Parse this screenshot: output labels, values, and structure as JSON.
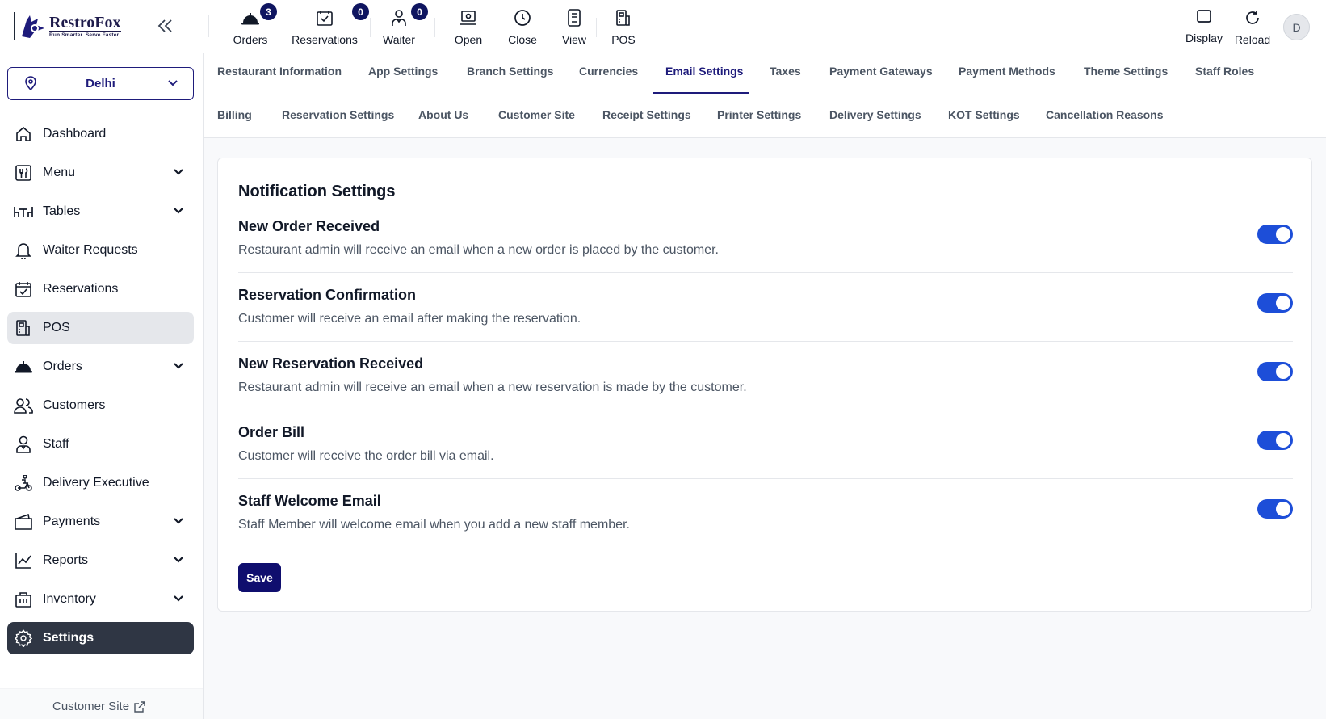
{
  "brand": {
    "name": "RestroFox",
    "tagline": "Run Smarter. Serve Faster"
  },
  "topbar": {
    "buttons": [
      {
        "label": "Orders",
        "badge": "3",
        "icon": "service-bell-icon"
      },
      {
        "label": "Reservations",
        "badge": "0",
        "icon": "calendar-check-icon"
      },
      {
        "label": "Waiter",
        "badge": "0",
        "icon": "waiter-icon"
      },
      {
        "label": "Open",
        "icon": "cash-register-icon"
      },
      {
        "label": "Close",
        "icon": "clock-icon"
      },
      {
        "label": "View",
        "icon": "tablet-icon"
      },
      {
        "label": "POS",
        "icon": "pos-terminal-icon"
      }
    ],
    "right": [
      {
        "label": "Display",
        "icon": "square-icon"
      },
      {
        "label": "Reload",
        "icon": "reload-icon"
      }
    ],
    "avatar_initial": "D"
  },
  "sidebar": {
    "branch": "Delhi",
    "items": [
      {
        "label": "Dashboard",
        "icon": "home-icon"
      },
      {
        "label": "Menu",
        "icon": "menu-book-icon",
        "expandable": true
      },
      {
        "label": "Tables",
        "icon": "table-icon",
        "expandable": true
      },
      {
        "label": "Waiter Requests",
        "icon": "bell-icon"
      },
      {
        "label": "Reservations",
        "icon": "calendar-check-icon"
      },
      {
        "label": "POS",
        "icon": "pos-terminal-icon",
        "state": "hover"
      },
      {
        "label": "Orders",
        "icon": "service-bell-icon",
        "expandable": true
      },
      {
        "label": "Customers",
        "icon": "users-icon"
      },
      {
        "label": "Staff",
        "icon": "staff-icon"
      },
      {
        "label": "Delivery Executive",
        "icon": "scooter-icon"
      },
      {
        "label": "Payments",
        "icon": "wallet-icon",
        "expandable": true
      },
      {
        "label": "Reports",
        "icon": "chart-line-icon",
        "expandable": true
      },
      {
        "label": "Inventory",
        "icon": "inventory-icon",
        "expandable": true
      },
      {
        "label": "Settings",
        "icon": "gear-icon",
        "state": "active"
      }
    ],
    "footer_link": "Customer Site"
  },
  "tabs": {
    "row1": [
      "Restaurant Information",
      "App Settings",
      "Branch Settings",
      "Currencies",
      "Email Settings",
      "Taxes",
      "Payment Gateways",
      "Payment Methods",
      "Theme Settings",
      "Staff Roles"
    ],
    "row2": [
      "Billing",
      "Reservation Settings",
      "About Us",
      "Customer Site",
      "Receipt Settings",
      "Printer Settings",
      "Delivery Settings",
      "KOT Settings",
      "Cancellation Reasons"
    ],
    "active": "Email Settings"
  },
  "notification": {
    "title": "Notification Settings",
    "settings": [
      {
        "title": "New Order Received",
        "desc": "Restaurant admin will receive an email when a new order is placed by the customer.",
        "enabled": true
      },
      {
        "title": "Reservation Confirmation",
        "desc": "Customer will receive an email after making the reservation.",
        "enabled": true
      },
      {
        "title": "New Reservation Received",
        "desc": "Restaurant admin will receive an email when a new reservation is made by the customer.",
        "enabled": true
      },
      {
        "title": "Order Bill",
        "desc": "Customer will receive the order bill via email.",
        "enabled": true
      },
      {
        "title": "Staff Welcome Email",
        "desc": "Staff Member will welcome email when you add a new staff member.",
        "enabled": true
      }
    ],
    "save_label": "Save"
  },
  "colors": {
    "primary": "#1e1b7b",
    "toggle": "#1d4ed8",
    "sidebar_active": "#2f3644"
  }
}
